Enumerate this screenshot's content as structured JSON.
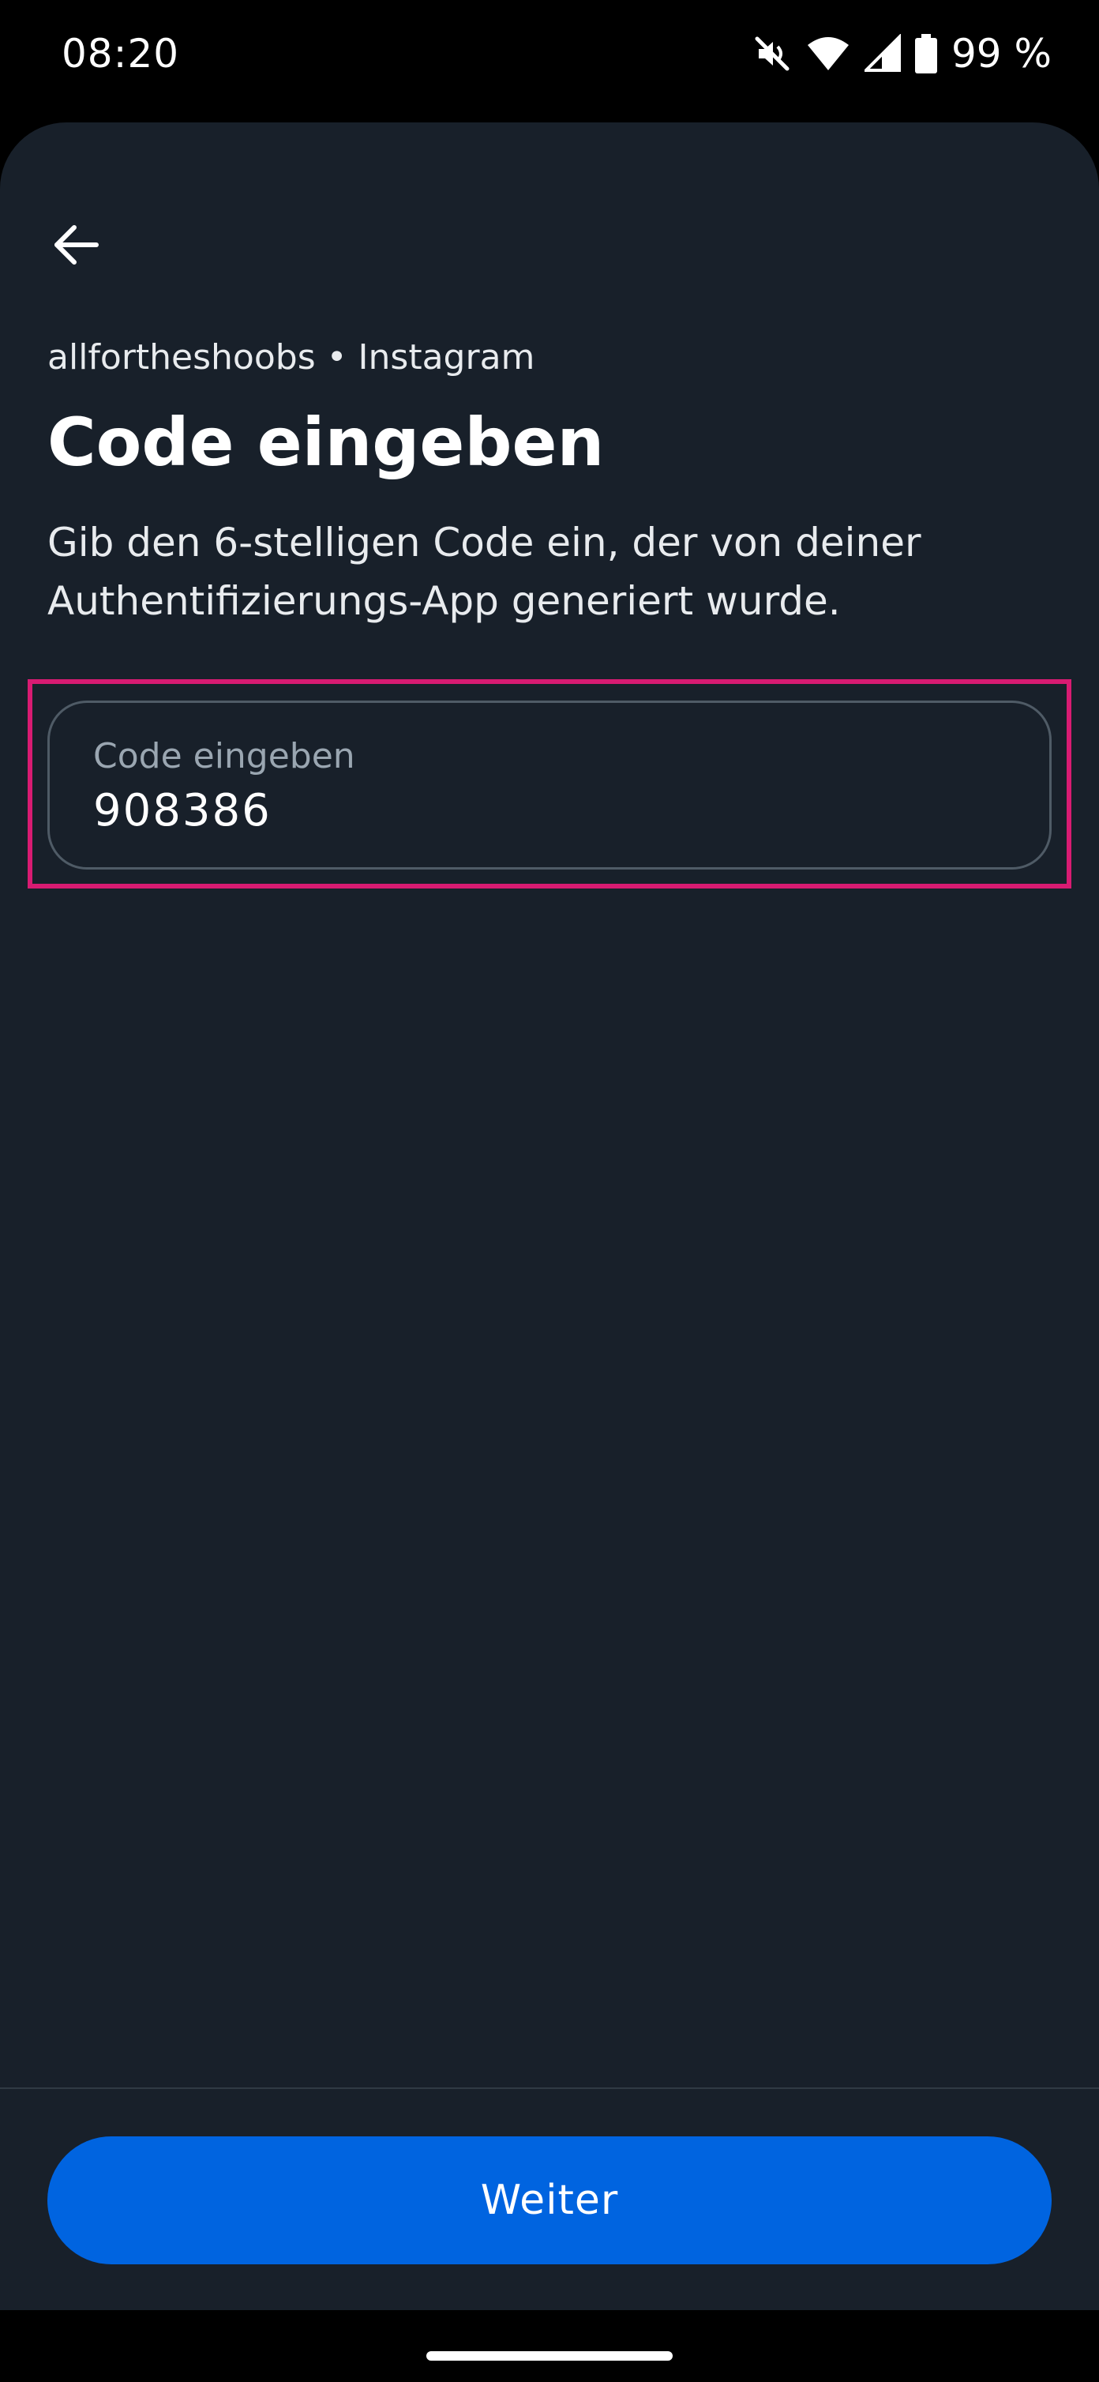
{
  "status_bar": {
    "time": "08:20",
    "battery": "99 %",
    "icons": [
      "mute-icon",
      "wifi-icon",
      "signal-icon",
      "battery-icon"
    ]
  },
  "header": {
    "back_icon": "arrow-left-icon"
  },
  "account": {
    "line": "allfortheshoobs • Instagram"
  },
  "page": {
    "title": "Code eingeben",
    "description": "Gib den 6-stelligen Code ein, der von deiner Authentifizierungs-App generiert wurde."
  },
  "code_field": {
    "label": "Code eingeben",
    "value": "908386"
  },
  "footer": {
    "continue_label": "Weiter"
  },
  "colors": {
    "background": "#18202a",
    "primary": "#0064e0",
    "highlight": "#d81b72"
  }
}
